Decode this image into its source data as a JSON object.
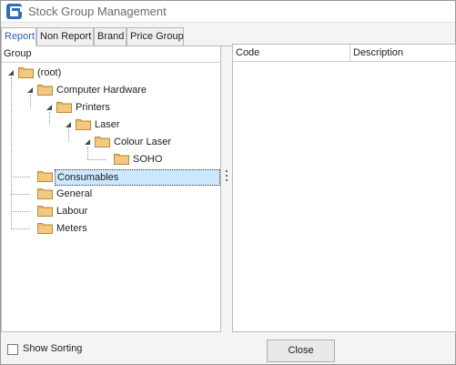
{
  "window": {
    "title": "Stock Group Management"
  },
  "tabs": [
    {
      "label": "Report",
      "active": true
    },
    {
      "label": "Non Report",
      "active": false
    },
    {
      "label": "Brand",
      "active": false
    },
    {
      "label": "Price Group",
      "active": false
    }
  ],
  "tree": {
    "header": "Group",
    "nodes": [
      {
        "label": "(root)",
        "expanded": true
      },
      {
        "label": "Computer Hardware",
        "expanded": true
      },
      {
        "label": "Printers",
        "expanded": true
      },
      {
        "label": "Laser",
        "expanded": true
      },
      {
        "label": "Colour Laser",
        "expanded": true
      },
      {
        "label": "SOHO",
        "expanded": false
      },
      {
        "label": "Consumables",
        "expanded": false,
        "selected": true
      },
      {
        "label": "General",
        "expanded": false
      },
      {
        "label": "Labour",
        "expanded": false
      },
      {
        "label": "Meters",
        "expanded": false
      }
    ]
  },
  "grid": {
    "columns": [
      "Code",
      "Description"
    ],
    "rows": []
  },
  "footer": {
    "show_sorting_label": "Show Sorting",
    "show_sorting_checked": false,
    "close_label": "Close"
  },
  "colors": {
    "accent": "#2a63b0",
    "selection": "#cce8ff",
    "folder": "#e8b868",
    "title_icon": "#2e6fb7"
  },
  "icons": [
    "app-icon",
    "folder-icon",
    "expand-arrow-icon",
    "grip-icon"
  ]
}
